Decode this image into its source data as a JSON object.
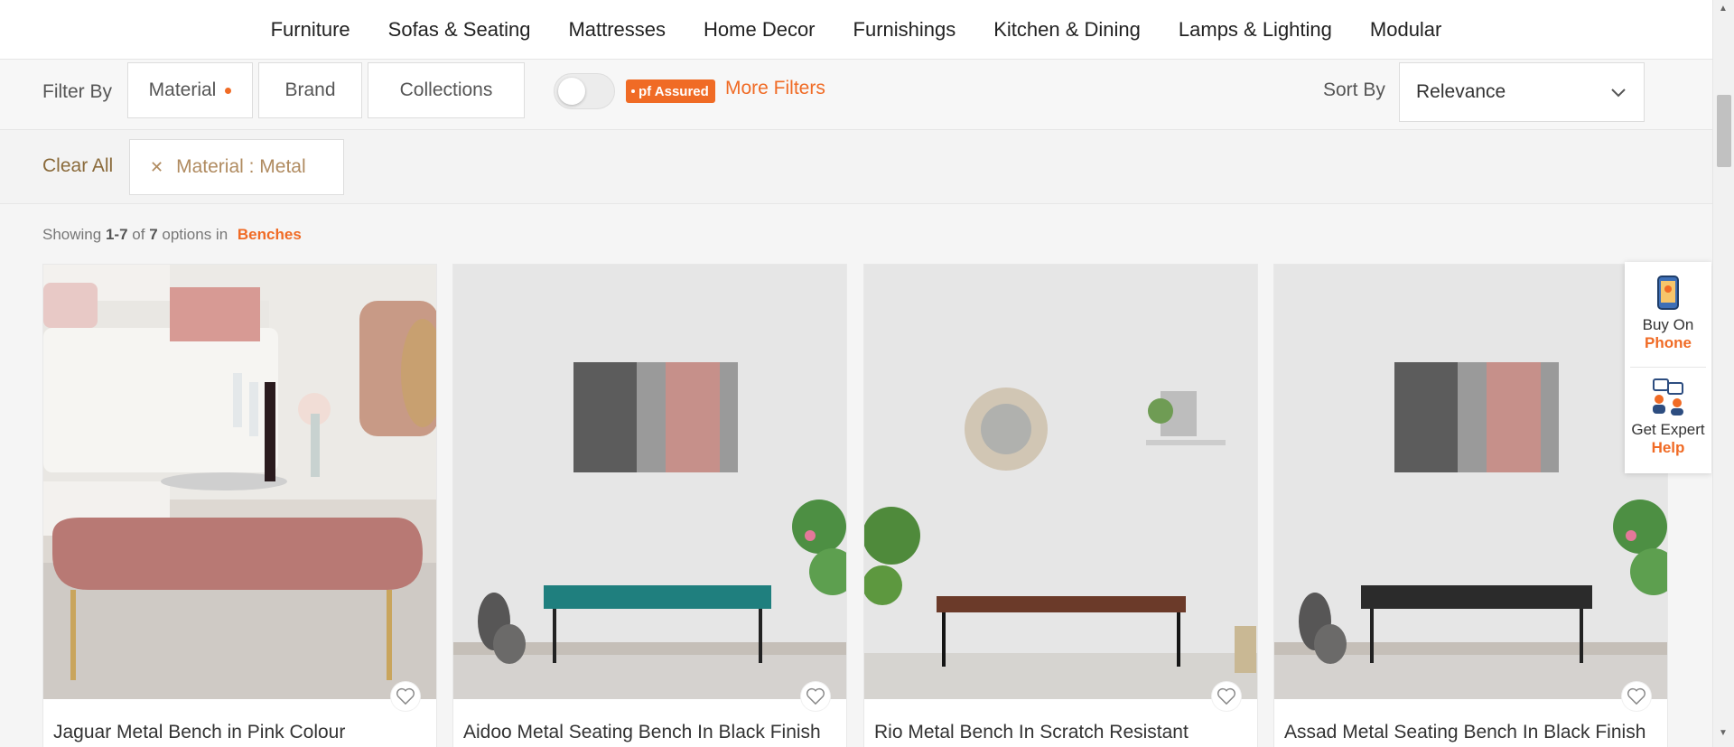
{
  "nav": {
    "items": [
      "Furniture",
      "Sofas & Seating",
      "Mattresses",
      "Home Decor",
      "Furnishings",
      "Kitchen & Dining",
      "Lamps & Lighting",
      "Modular"
    ]
  },
  "filters": {
    "label": "Filter By",
    "buttons": [
      "Material",
      "Brand",
      "Collections"
    ],
    "material_active": true,
    "assured_badge": "pf Assured",
    "more_filters": "More Filters",
    "assured_toggle_on": false
  },
  "sort": {
    "label": "Sort By",
    "selected": "Relevance"
  },
  "applied": {
    "clear_all": "Clear All",
    "chip": "Material : Metal"
  },
  "results": {
    "prefix": "Showing",
    "range": "1-7",
    "of": "of",
    "total": "7",
    "suffix": "options in",
    "category": "Benches"
  },
  "products": [
    {
      "title": "Jaguar Metal Bench in Pink Colour"
    },
    {
      "title": "Aidoo Metal Seating Bench In Black Finish"
    },
    {
      "title": "Rio Metal Bench In Scratch Resistant"
    },
    {
      "title": "Assad Metal Seating Bench In Black Finish"
    }
  ],
  "help": {
    "phone_line1": "Buy On",
    "phone_line2": "Phone",
    "expert_line1": "Get Expert",
    "expert_line2": "Help"
  },
  "colors": {
    "accent": "#f06b25",
    "chip_text": "#b08b60"
  }
}
